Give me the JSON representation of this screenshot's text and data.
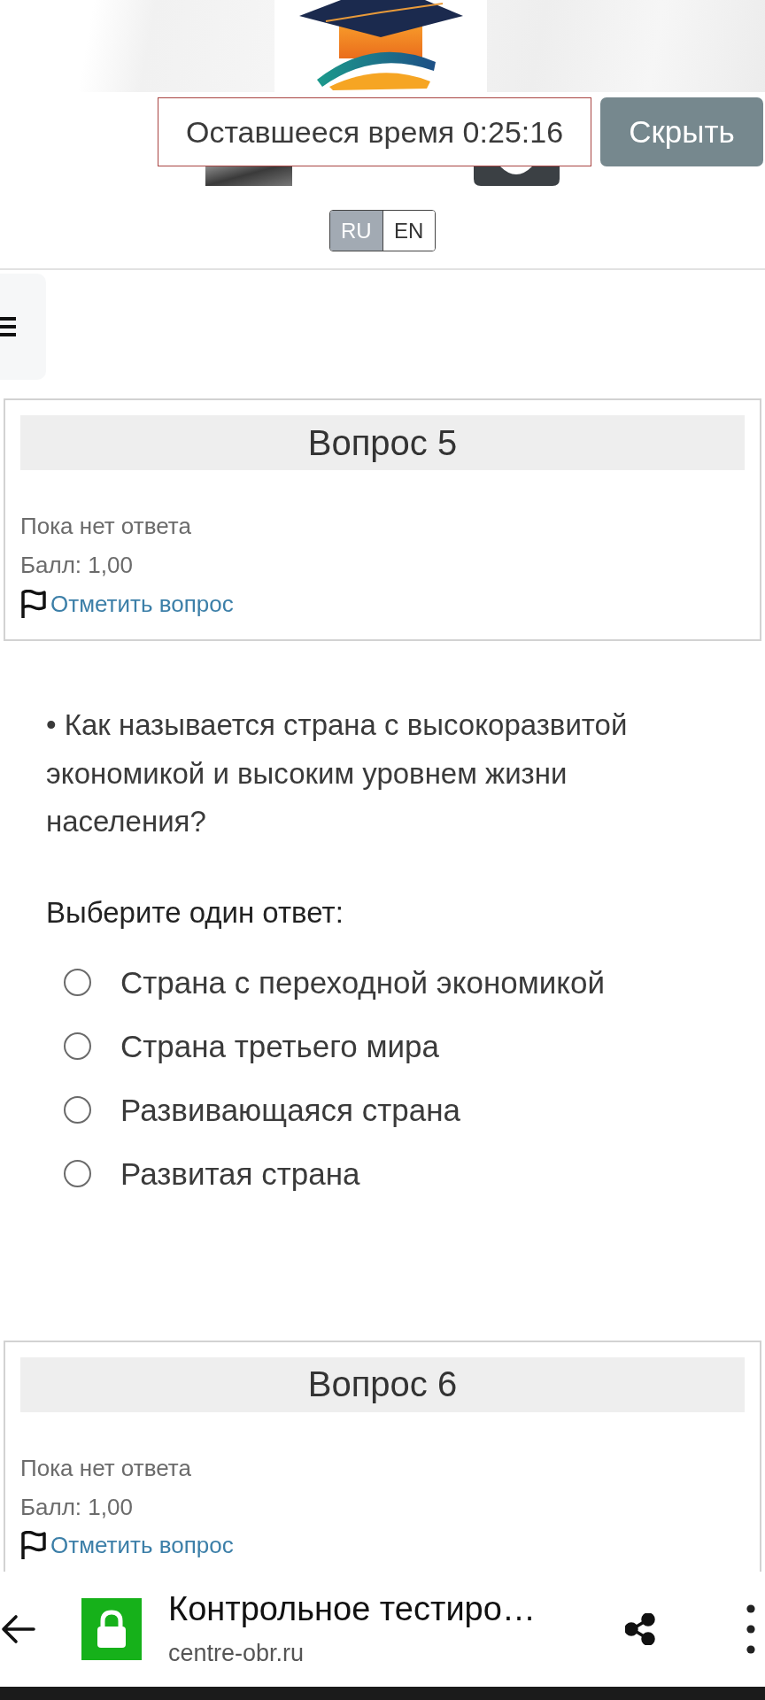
{
  "header": {
    "timer": "Оставшееся время 0:25:16",
    "hide_button": "Скрыть",
    "languages": [
      {
        "label": "RU",
        "selected": true
      },
      {
        "label": "EN",
        "selected": false
      }
    ]
  },
  "questions": [
    {
      "title": "Вопрос 5",
      "status": "Пока нет ответа",
      "score": "Балл: 1,00",
      "flag_link": "Отметить вопрос",
      "text": "• Как называется страна с высокоразвитой экономикой и высоким уровнем жизни населения?",
      "prompt": "Выберите один ответ:",
      "options": [
        {
          "label": "Страна с переходной экономикой",
          "selected": false
        },
        {
          "label": "Страна третьего мира",
          "selected": false
        },
        {
          "label": "Развивающаяся страна",
          "selected": false
        },
        {
          "label": "Развитая страна",
          "selected": false
        }
      ]
    },
    {
      "title": "Вопрос 6",
      "status": "Пока нет ответа",
      "score": "Балл: 1,00",
      "flag_link": "Отметить вопрос"
    }
  ],
  "browser_bar": {
    "title": "Контрольное тестиро…",
    "url": "centre-obr.ru"
  }
}
